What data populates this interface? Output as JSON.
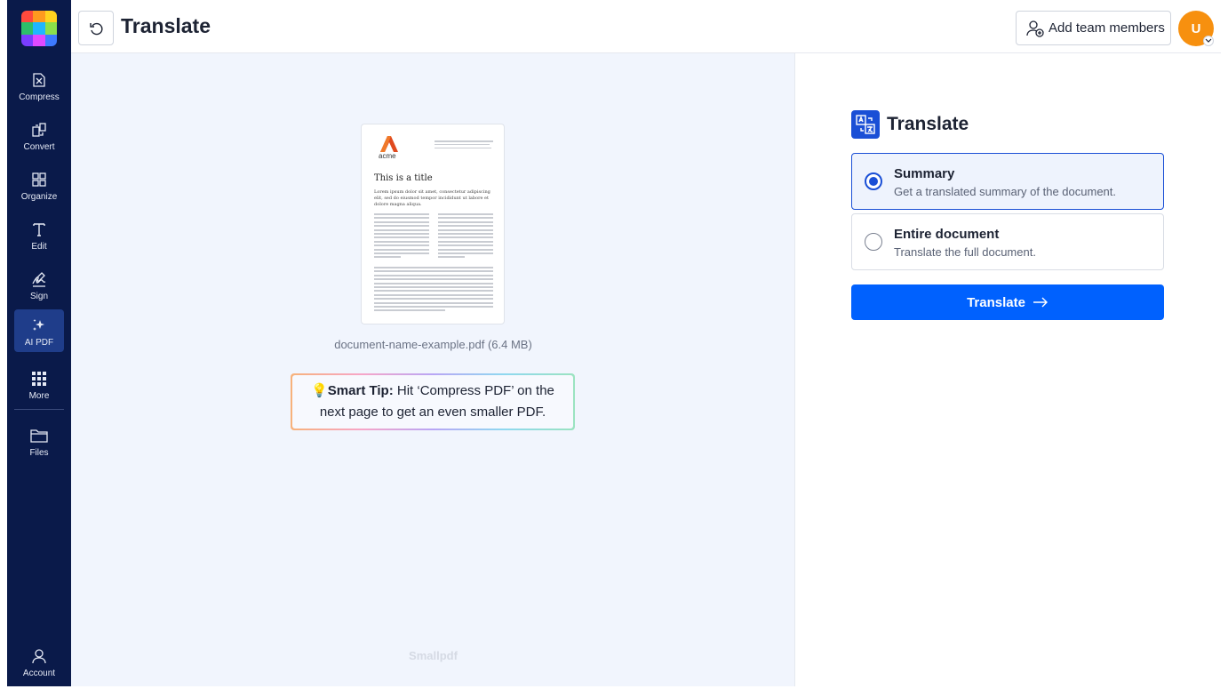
{
  "header": {
    "title": "Translate",
    "add_team_label": "Add team members",
    "avatar_initial": "U"
  },
  "sidebar": {
    "items": [
      {
        "label": "Compress",
        "icon": "compress-icon"
      },
      {
        "label": "Convert",
        "icon": "convert-icon"
      },
      {
        "label": "Organize",
        "icon": "organize-icon"
      },
      {
        "label": "Edit",
        "icon": "edit-icon"
      },
      {
        "label": "Sign",
        "icon": "sign-icon"
      },
      {
        "label": "AI PDF",
        "icon": "sparkles-icon",
        "active": true
      },
      {
        "label": "More",
        "icon": "grid-icon"
      },
      {
        "label": "Files",
        "icon": "folder-icon"
      }
    ],
    "account_label": "Account"
  },
  "preview": {
    "doc_logo_text": "acme",
    "doc_title": "This is a title",
    "doc_intro": "Lorem ipsum dolor sit amet, consectetur adipiscing elit, sed do eiusmod tempor incididunt ut labore et dolore magna aliqua.",
    "file_name": "document-name-example.pdf",
    "file_size": "(6.4 MB)",
    "tip_label": "Smart Tip:",
    "tip_text": "Hit ‘Compress PDF’ on the next page to get an even smaller PDF.",
    "brand": "Smallpdf"
  },
  "panel": {
    "title": "Translate",
    "options": [
      {
        "title": "Summary",
        "description": "Get a translated summary of the document.",
        "selected": true
      },
      {
        "title": "Entire document",
        "description": "Translate the full document.",
        "selected": false
      }
    ],
    "button_label": "Translate"
  },
  "colors": {
    "sidebar_bg": "#0a1a4a",
    "accent": "#0061fe",
    "avatar": "#f7900f"
  }
}
